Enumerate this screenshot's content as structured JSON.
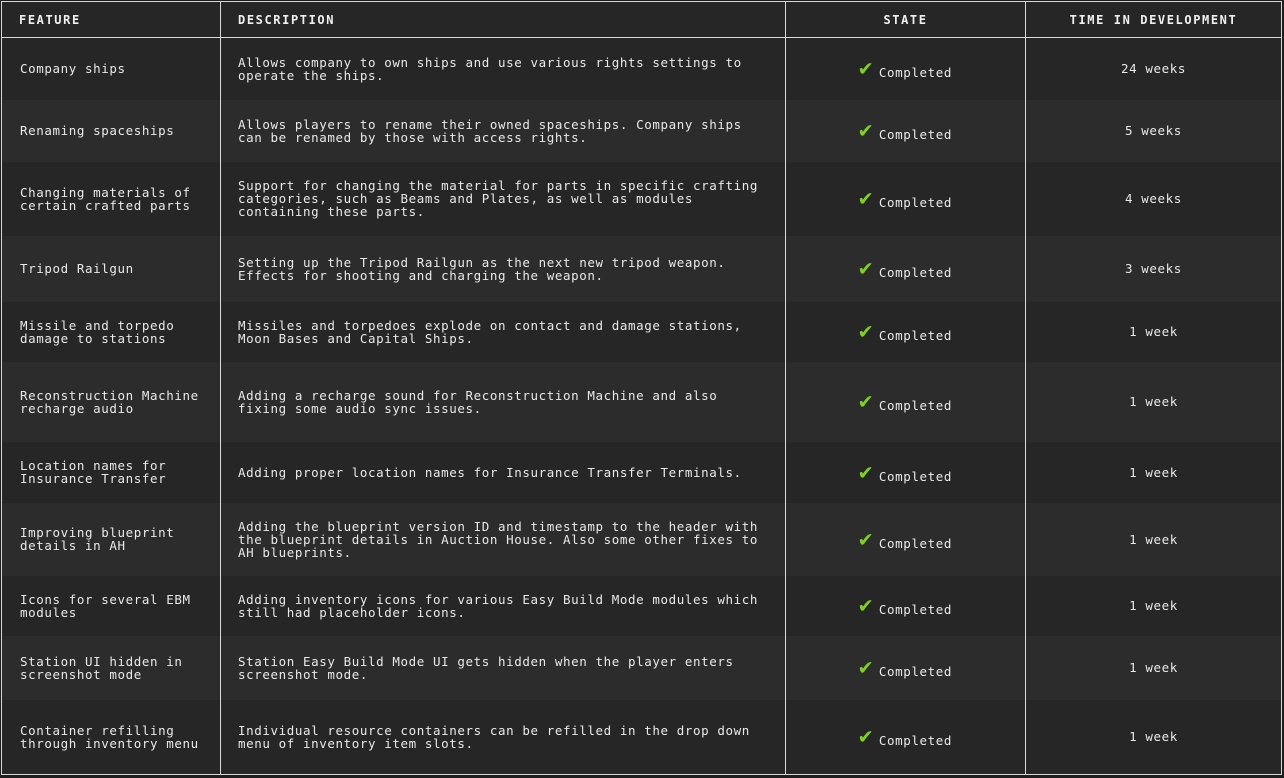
{
  "table": {
    "headers": {
      "feature": "Feature",
      "description": "Description",
      "state": "State",
      "time": "Time in development"
    },
    "status_color": "#7ed321",
    "rows": [
      {
        "feature": "Company ships",
        "description": "Allows company to own ships and use various rights settings to operate the ships.",
        "state_icon": "check-icon",
        "state": "Completed",
        "time": "24 weeks"
      },
      {
        "feature": "Renaming spaceships",
        "description": "Allows players to rename their owned spaceships. Company ships can be renamed by those with access rights.",
        "state_icon": "check-icon",
        "state": "Completed",
        "time": "5 weeks"
      },
      {
        "feature": "Changing materials of certain crafted parts",
        "description": "Support for changing the material for parts in specific crafting categories, such as Beams and Plates, as well as modules containing these parts.",
        "state_icon": "check-icon",
        "state": "Completed",
        "time": "4 weeks"
      },
      {
        "feature": "Tripod Railgun",
        "description": "Setting up the Tripod Railgun as the next new tripod weapon. Effects for shooting and charging the weapon.",
        "state_icon": "check-icon",
        "state": "Completed",
        "time": "3 weeks"
      },
      {
        "feature": "Missile and torpedo damage to stations",
        "description": "Missiles and torpedoes explode on contact and damage stations, Moon Bases and Capital Ships.",
        "state_icon": "check-icon",
        "state": "Completed",
        "time": "1 week"
      },
      {
        "feature": "Reconstruction Machine recharge audio",
        "description": "Adding a recharge sound for Reconstruction Machine and also fixing some audio sync issues.",
        "state_icon": "check-icon",
        "state": "Completed",
        "time": "1 week"
      },
      {
        "feature": "Location names for Insurance Transfer",
        "description": "Adding proper location names for Insurance Transfer Terminals.",
        "state_icon": "check-icon",
        "state": "Completed",
        "time": "1 week"
      },
      {
        "feature": "Improving blueprint details in AH",
        "description": "Adding the blueprint version ID and timestamp to the header with the blueprint details in Auction House. Also some other fixes to AH blueprints.",
        "state_icon": "check-icon",
        "state": "Completed",
        "time": "1 week"
      },
      {
        "feature": "Icons for several EBM modules",
        "description": "Adding inventory icons for various Easy Build Mode modules which still had placeholder icons.",
        "state_icon": "check-icon",
        "state": "Completed",
        "time": "1 week"
      },
      {
        "feature": "Station UI hidden in screenshot mode",
        "description": "Station Easy Build Mode UI gets hidden when the player enters screenshot mode.",
        "state_icon": "check-icon",
        "state": "Completed",
        "time": "1 week"
      },
      {
        "feature": "Container refilling through inventory menu",
        "description": "Individual resource containers can be refilled in the drop down menu of inventory item slots.",
        "state_icon": "check-icon",
        "state": "Completed",
        "time": "1 week"
      }
    ]
  }
}
